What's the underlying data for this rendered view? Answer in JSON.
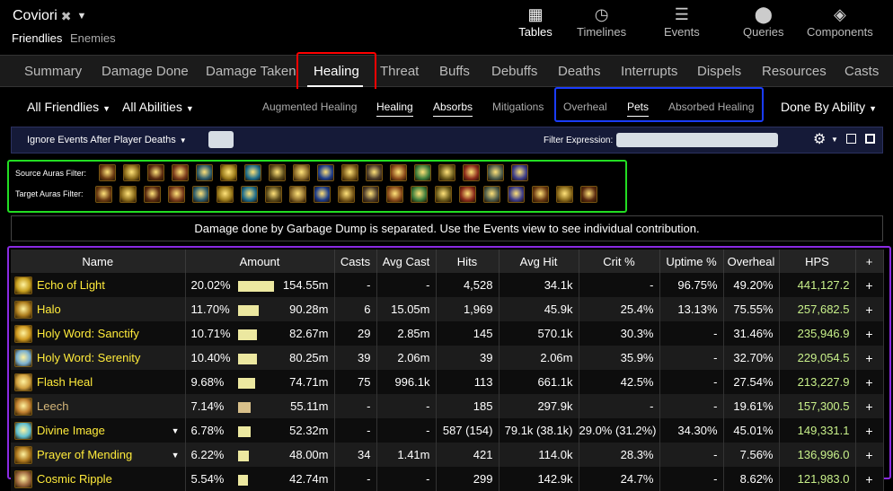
{
  "header": {
    "title": "Coviori",
    "subtitle_active": "Friendlies",
    "subtitle_other": "Enemies"
  },
  "top_nav": [
    {
      "label": "Tables",
      "icon": "table-icon",
      "active": true
    },
    {
      "label": "Timelines",
      "icon": "clock-icon",
      "active": false
    },
    {
      "label": "Events",
      "icon": "list-icon",
      "active": false
    },
    {
      "label": "Queries",
      "icon": "map-pin-icon",
      "active": false
    },
    {
      "label": "Components",
      "icon": "components-icon",
      "active": false
    }
  ],
  "tabs": [
    "Summary",
    "Damage Done",
    "Damage Taken",
    "Healing",
    "Threat",
    "Buffs",
    "Debuffs",
    "Deaths",
    "Interrupts",
    "Dispels",
    "Resources",
    "Casts"
  ],
  "active_tab": "Healing",
  "filters": {
    "friendlies": "All Friendlies",
    "abilities": "All Abilities",
    "modes": [
      "Augmented Healing",
      "Healing",
      "Absorbs",
      "Mitigations",
      "Overheal",
      "Pets",
      "Absorbed Healing"
    ],
    "group_by": "Done By Ability",
    "ignore_events": "Ignore Events After Player Deaths",
    "filter_expression_label": "Filter Expression:"
  },
  "auras": {
    "source_label": "Source Auras Filter:",
    "target_label": "Target Auras Filter:"
  },
  "notice": "Damage done by Garbage Dump is separated. Use the Events view to see individual contribution.",
  "table": {
    "columns": [
      "Name",
      "Amount",
      "Casts",
      "Avg Cast",
      "Hits",
      "Avg Hit",
      "Crit %",
      "Uptime %",
      "Overheal",
      "HPS",
      "+"
    ],
    "rows": [
      {
        "name": "Echo of Light",
        "pct": "20.02%",
        "bar": 0.2002,
        "amount": "154.55m",
        "casts": "-",
        "avg_cast": "-",
        "hits": "4,528",
        "avg_hit": "34.1k",
        "crit": "-",
        "uptime": "96.75%",
        "overheal": "49.20%",
        "hps": "441,127.2",
        "caret": false
      },
      {
        "name": "Halo",
        "pct": "11.70%",
        "bar": 0.117,
        "amount": "90.28m",
        "casts": "6",
        "avg_cast": "15.05m",
        "hits": "1,969",
        "avg_hit": "45.9k",
        "crit": "25.4%",
        "uptime": "13.13%",
        "overheal": "75.55%",
        "hps": "257,682.5",
        "caret": false
      },
      {
        "name": "Holy Word: Sanctify",
        "pct": "10.71%",
        "bar": 0.1071,
        "amount": "82.67m",
        "casts": "29",
        "avg_cast": "2.85m",
        "hits": "145",
        "avg_hit": "570.1k",
        "crit": "30.3%",
        "uptime": "-",
        "overheal": "31.46%",
        "hps": "235,946.9",
        "caret": false
      },
      {
        "name": "Holy Word: Serenity",
        "pct": "10.40%",
        "bar": 0.104,
        "amount": "80.25m",
        "casts": "39",
        "avg_cast": "2.06m",
        "hits": "39",
        "avg_hit": "2.06m",
        "crit": "35.9%",
        "uptime": "-",
        "overheal": "32.70%",
        "hps": "229,054.5",
        "caret": false
      },
      {
        "name": "Flash Heal",
        "pct": "9.68%",
        "bar": 0.0968,
        "amount": "74.71m",
        "casts": "75",
        "avg_cast": "996.1k",
        "hits": "113",
        "avg_hit": "661.1k",
        "crit": "42.5%",
        "uptime": "-",
        "overheal": "27.54%",
        "hps": "213,227.9",
        "caret": false
      },
      {
        "name": "Leech",
        "pct": "7.14%",
        "bar": 0.0714,
        "amount": "55.11m",
        "casts": "-",
        "avg_cast": "-",
        "hits": "185",
        "avg_hit": "297.9k",
        "crit": "-",
        "uptime": "-",
        "overheal": "19.61%",
        "hps": "157,300.5",
        "caret": false
      },
      {
        "name": "Divine Image",
        "pct": "6.78%",
        "bar": 0.0678,
        "amount": "52.32m",
        "casts": "-",
        "avg_cast": "-",
        "hits": "587 (154)",
        "avg_hit": "79.1k (38.1k)",
        "crit": "29.0% (31.2%)",
        "uptime": "34.30%",
        "overheal": "45.01%",
        "hps": "149,331.1",
        "caret": true
      },
      {
        "name": "Prayer of Mending",
        "pct": "6.22%",
        "bar": 0.0622,
        "amount": "48.00m",
        "casts": "34",
        "avg_cast": "1.41m",
        "hits": "421",
        "avg_hit": "114.0k",
        "crit": "28.3%",
        "uptime": "-",
        "overheal": "7.56%",
        "hps": "136,996.0",
        "caret": true
      },
      {
        "name": "Cosmic Ripple",
        "pct": "5.54%",
        "bar": 0.0554,
        "amount": "42.74m",
        "casts": "-",
        "avg_cast": "-",
        "hits": "299",
        "avg_hit": "142.9k",
        "crit": "24.7%",
        "uptime": "-",
        "overheal": "8.62%",
        "hps": "121,983.0",
        "caret": false
      }
    ]
  },
  "colors": {
    "highlight_red": "#ff0000",
    "highlight_blue": "#1a3cff",
    "highlight_green": "#22dd22",
    "highlight_purple": "#8a2be2",
    "ability_name": "#ffeb3b",
    "hps": "#c8f08a"
  }
}
